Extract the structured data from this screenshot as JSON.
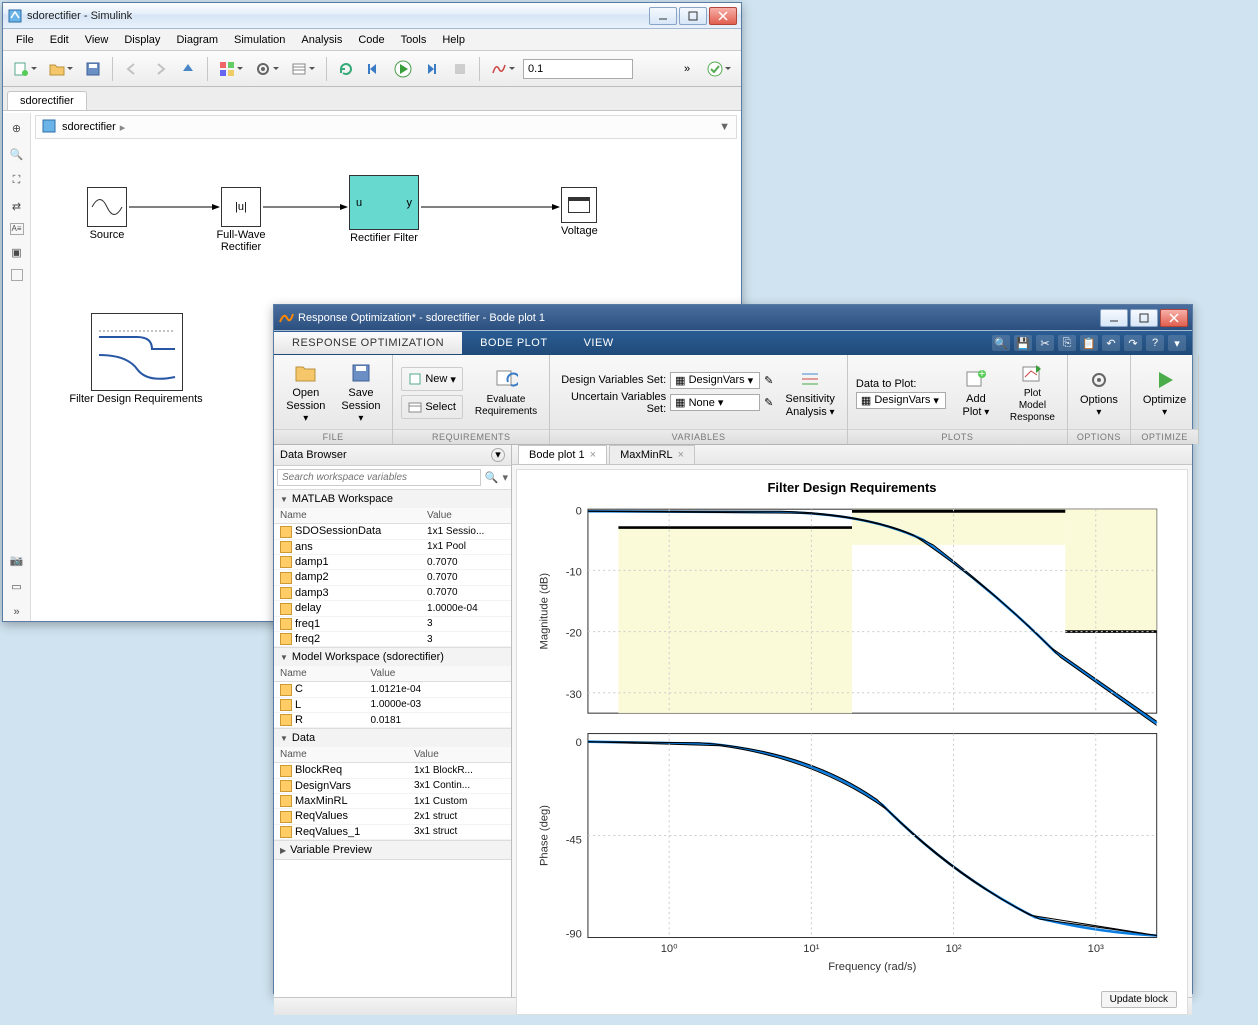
{
  "simulink": {
    "title": "sdorectifier - Simulink",
    "menus": [
      "File",
      "Edit",
      "View",
      "Display",
      "Diagram",
      "Simulation",
      "Analysis",
      "Code",
      "Tools",
      "Help"
    ],
    "step": "0.1",
    "tab": "sdorectifier",
    "breadcrumb": "sdorectifier",
    "blocks": {
      "source": "Source",
      "fullwave": "Full-Wave Rectifier",
      "fullwave_sym": "|u|",
      "filter": "Rectifier Filter",
      "filter_u": "u",
      "filter_y": "y",
      "voltage": "Voltage",
      "req": "Filter Design Requirements"
    }
  },
  "ro": {
    "title": "Response Optimization* - sdorectifier - Bode plot 1",
    "tabs": [
      "RESPONSE OPTIMIZATION",
      "BODE PLOT",
      "VIEW"
    ],
    "ribbon": {
      "open": "Open Session",
      "save": "Save Session",
      "new": "New",
      "select": "Select",
      "eval": "Evaluate Requirements",
      "dvset_label": "Design Variables Set:",
      "dvset_value": "DesignVars",
      "uvset_label": "Uncertain Variables Set:",
      "uvset_value": "None",
      "sens": "Sensitivity Analysis",
      "datatoplot_label": "Data to Plot:",
      "datatoplot_value": "DesignVars",
      "addplot": "Add Plot",
      "plotmodel": "Plot Model Response",
      "options": "Options",
      "optimize": "Optimize",
      "groups": [
        "FILE",
        "REQUIREMENTS",
        "VARIABLES",
        "PLOTS",
        "OPTIONS",
        "OPTIMIZE"
      ]
    },
    "databrowser": {
      "title": "Data Browser",
      "search_ph": "Search workspace variables",
      "sections": {
        "matlab": {
          "title": "MATLAB Workspace",
          "cols": [
            "Name",
            "Value"
          ],
          "rows": [
            [
              "SDOSessionData",
              "1x1 Sessio..."
            ],
            [
              "ans",
              "1x1 Pool"
            ],
            [
              "damp1",
              "0.7070"
            ],
            [
              "damp2",
              "0.7070"
            ],
            [
              "damp3",
              "0.7070"
            ],
            [
              "delay",
              "1.0000e-04"
            ],
            [
              "freq1",
              "3"
            ],
            [
              "freq2",
              "3"
            ]
          ]
        },
        "model": {
          "title": "Model Workspace (sdorectifier)",
          "cols": [
            "Name",
            "Value"
          ],
          "rows": [
            [
              "C",
              "1.0121e-04"
            ],
            [
              "L",
              "1.0000e-03"
            ],
            [
              "R",
              "0.0181"
            ]
          ]
        },
        "data": {
          "title": "Data",
          "cols": [
            "Name",
            "Value"
          ],
          "rows": [
            [
              "BlockReq",
              "1x1 BlockR..."
            ],
            [
              "DesignVars",
              "3x1 Contin..."
            ],
            [
              "MaxMinRL",
              "1x1 Custom"
            ],
            [
              "ReqValues",
              "2x1 struct"
            ],
            [
              "ReqValues_1",
              "3x1 struct"
            ]
          ]
        },
        "preview": {
          "title": "Variable Preview"
        }
      }
    },
    "doctabs": [
      "Bode plot 1",
      "MaxMinRL"
    ],
    "plot": {
      "title": "Filter Design Requirements",
      "xlabel": "Frequency  (rad/s)",
      "ylabel_mag": "Magnitude (dB)",
      "ylabel_phase": "Phase (deg)",
      "updatebtn": "Update block"
    }
  },
  "chart_data": [
    {
      "type": "line",
      "title": "Filter Design Requirements — Magnitude",
      "xlabel": "Frequency (rad/s)",
      "ylabel": "Magnitude (dB)",
      "x_scale": "log",
      "xlim": [
        0.3,
        3000
      ],
      "ylim": [
        -35,
        3
      ],
      "xticks": [
        1,
        10,
        100,
        1000
      ],
      "yticks": [
        0,
        -10,
        -20,
        -30
      ],
      "constraints": [
        {
          "name": "lower_bound_1",
          "x": [
            0.6,
            20
          ],
          "y": [
            -3,
            -3
          ]
        },
        {
          "name": "upper_bound_1",
          "x": [
            20,
            1000
          ],
          "y": [
            0,
            0
          ]
        },
        {
          "name": "upper_bound_2",
          "x": [
            1000,
            3000
          ],
          "y": [
            -20,
            -20
          ]
        }
      ],
      "series": [
        {
          "name": "resp1",
          "x": [
            0.3,
            1,
            3,
            10,
            20,
            30,
            50,
            100,
            200,
            500,
            1000,
            3000
          ],
          "y": [
            0,
            0,
            0,
            -0.2,
            -0.7,
            -1.5,
            -3.5,
            -9,
            -16,
            -25,
            -31,
            -40
          ]
        },
        {
          "name": "resp2",
          "x": [
            0.3,
            1,
            3,
            10,
            20,
            30,
            50,
            100,
            200,
            500,
            1000,
            3000
          ],
          "y": [
            0,
            0,
            0,
            -0.1,
            -0.4,
            -1.0,
            -2.5,
            -7,
            -14,
            -23,
            -29,
            -38
          ]
        },
        {
          "name": "resp3",
          "x": [
            0.3,
            1,
            3,
            10,
            20,
            30,
            50,
            100,
            200,
            500,
            1000,
            3000
          ],
          "y": [
            0,
            0,
            0,
            -0.3,
            -1.0,
            -2.0,
            -4.5,
            -11,
            -18,
            -27,
            -33,
            -42
          ]
        }
      ]
    },
    {
      "type": "line",
      "title": "Filter Design Requirements — Phase",
      "xlabel": "Frequency (rad/s)",
      "ylabel": "Phase (deg)",
      "x_scale": "log",
      "xlim": [
        0.3,
        3000
      ],
      "ylim": [
        -95,
        5
      ],
      "xticks": [
        1,
        10,
        100,
        1000
      ],
      "yticks": [
        0,
        -45,
        -90
      ],
      "series": [
        {
          "name": "resp1",
          "x": [
            0.3,
            1,
            3,
            10,
            20,
            30,
            50,
            100,
            200,
            500,
            1000,
            3000
          ],
          "y": [
            0,
            -1,
            -3,
            -10,
            -20,
            -30,
            -45,
            -65,
            -78,
            -86,
            -88,
            -90
          ]
        },
        {
          "name": "resp2",
          "x": [
            0.3,
            1,
            3,
            10,
            20,
            30,
            50,
            100,
            200,
            500,
            1000,
            3000
          ],
          "y": [
            0,
            -1,
            -2,
            -8,
            -16,
            -25,
            -40,
            -60,
            -75,
            -85,
            -88,
            -90
          ]
        },
        {
          "name": "resp3",
          "x": [
            0.3,
            1,
            3,
            10,
            20,
            30,
            50,
            100,
            200,
            500,
            1000,
            3000
          ],
          "y": [
            0,
            -1,
            -4,
            -12,
            -24,
            -35,
            -50,
            -70,
            -81,
            -87,
            -89,
            -90
          ]
        }
      ]
    }
  ]
}
